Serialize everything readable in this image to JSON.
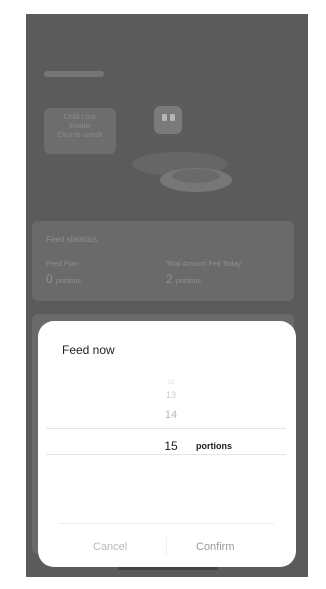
{
  "background": {
    "child_lock": {
      "line1": "Child Lock",
      "line2": "Enable",
      "line3": "Click to unlock"
    },
    "stats": {
      "title": "Feed statistics",
      "feed_plan_label": "Feed Plan",
      "feed_plan_value": "0",
      "feed_plan_unit": "portions",
      "total_label": "Total Amount Fed Today",
      "total_value": "2",
      "total_unit": "portions"
    }
  },
  "modal": {
    "title": "Feed now",
    "picker": {
      "items_above": [
        "12",
        "13",
        "14"
      ],
      "selected_value": "15",
      "unit": "portions"
    },
    "cancel_label": "Cancel",
    "confirm_label": "Confirm"
  },
  "colors": {
    "overlay": "#5b5b5b",
    "modal_bg": "#ffffff",
    "text_primary": "#1e1e1e",
    "text_muted": "#c3c3c3"
  }
}
